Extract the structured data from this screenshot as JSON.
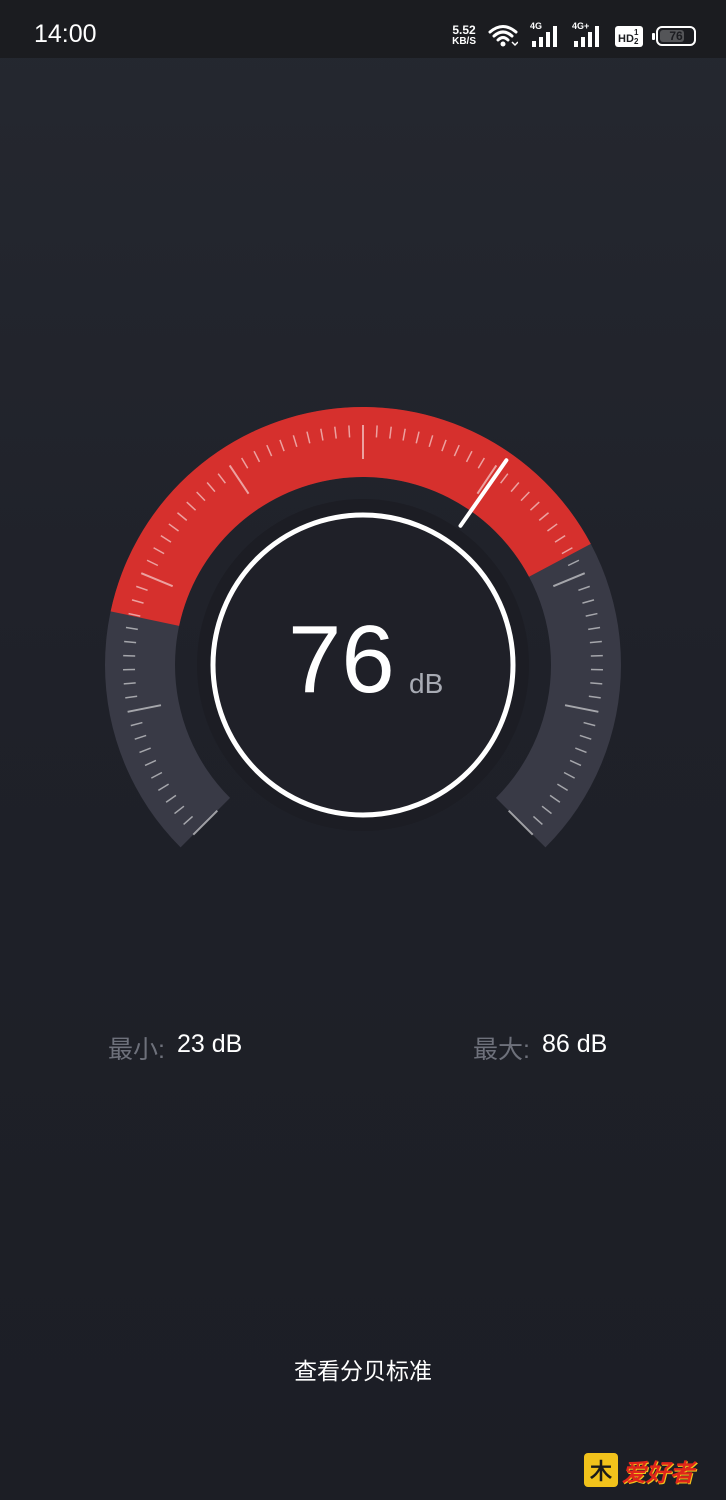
{
  "status_bar": {
    "time": "14:00",
    "net_speed_value": "5.52",
    "net_speed_unit": "KB/S",
    "signal1_tag": "4G",
    "signal2_tag": "4G+",
    "hd_label": "HD",
    "battery": "76",
    "battery_level": 0.76,
    "icons": [
      "wifi-icon",
      "signal-icon",
      "signal-icon",
      "hd-icon",
      "battery-icon"
    ]
  },
  "meter": {
    "value": "76",
    "unit": "dB",
    "current_db": 76,
    "range_db": [
      0,
      120
    ],
    "colors": {
      "active_arc": "#d6302d",
      "inactive_arc": "#393a46",
      "ring": "#ffffff",
      "needle": "#ffffff"
    }
  },
  "stats": {
    "min_label": "最小:",
    "min_value": "23 dB",
    "max_label": "最大:",
    "max_value": "86 dB"
  },
  "actions": {
    "view_standard": "查看分贝标准"
  },
  "watermark": {
    "logo_char": "木",
    "text": "爱好者"
  }
}
